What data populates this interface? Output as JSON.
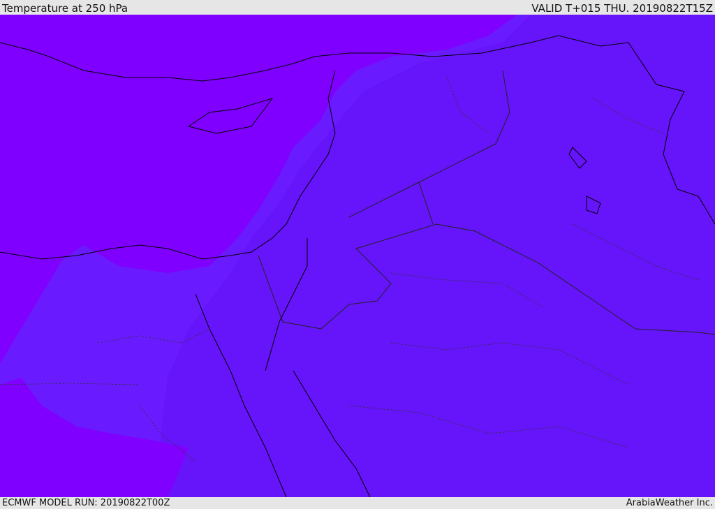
{
  "header": {
    "title": "Temperature at 250 hPa",
    "valid": "VALID T+015 THU. 20190822T15Z"
  },
  "footer": {
    "model_run": "ECMWF MODEL RUN: 20190822T00Z",
    "credit": "ArabiaWeather Inc."
  },
  "map": {
    "colors": {
      "cold_zone": "#8000ff",
      "mid_zone": "#6a1aff",
      "warm_zone": "#6614f9",
      "coastline": "#000000",
      "border": "#222222"
    }
  }
}
